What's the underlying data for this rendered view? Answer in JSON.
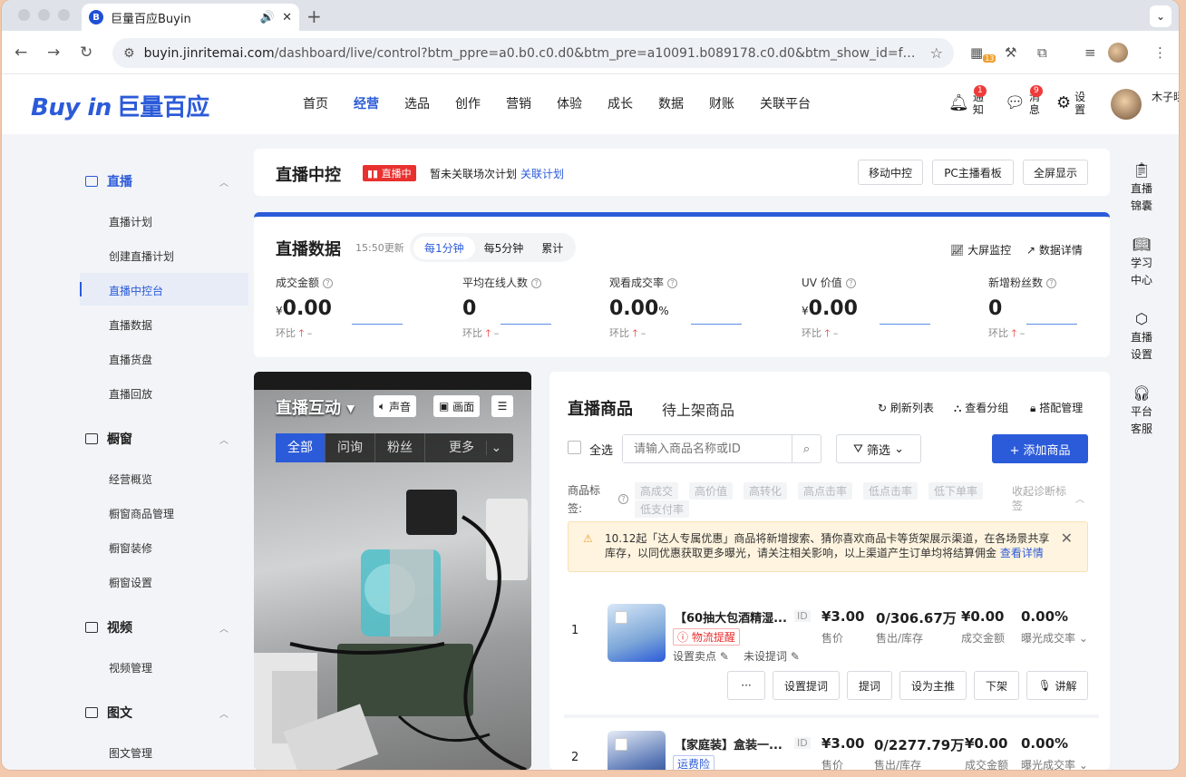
{
  "browser": {
    "tab_title": "巨量百应Buyin",
    "tab_favicon": "B",
    "url_domain": "buyin.jinritemai.com",
    "url_path": "/dashboard/live/control?btm_ppre=a0.b0.c0.d0&btm_pre=a10091.b089178.c0.d0&btm_show_id=fc90986...",
    "ext_badge": "13"
  },
  "header": {
    "logo_en": "Buy in",
    "logo_cn": "巨量百应",
    "nav": [
      "首页",
      "经营",
      "选品",
      "创作",
      "营销",
      "体验",
      "成长",
      "数据",
      "财账",
      "关联平台"
    ],
    "active_nav": "经营",
    "notify_label": "通知",
    "notify_badge": "1",
    "message_label": "消息",
    "message_badge": "9",
    "settings_label": "设置",
    "username": "木子旸"
  },
  "sidebar": {
    "live": "直播",
    "live_items": [
      "直播计划",
      "创建直播计划",
      "直播中控台",
      "直播数据",
      "直播货盘",
      "直播回放"
    ],
    "window": "橱窗",
    "window_items": [
      "经营概览",
      "橱窗商品管理",
      "橱窗装修",
      "橱窗设置"
    ],
    "video": "视频",
    "video_items": [
      "视频管理"
    ],
    "article": "图文",
    "article_items": [
      "图文管理"
    ]
  },
  "rail": [
    "直播锦囊",
    "学习中心",
    "直播设置",
    "平台客服"
  ],
  "control": {
    "title": "直播中控",
    "live_tag": "直播中",
    "plan_text": "暂未关联场次计划",
    "plan_link": "关联计划",
    "buttons": [
      "移动中控",
      "PC主播看板",
      "全屏显示"
    ]
  },
  "stats": {
    "title": "直播数据",
    "updated": "15:50更新",
    "intervals": [
      "每1分钟",
      "每5分钟",
      "累计"
    ],
    "big_screen": "大屏监控",
    "detail": "数据详情",
    "compare": "环比",
    "dash": "–",
    "metrics": [
      {
        "label": "成交金额",
        "prefix": "¥",
        "value": "0.00",
        "suffix": ""
      },
      {
        "label": "平均在线人数",
        "prefix": "",
        "value": "0",
        "suffix": ""
      },
      {
        "label": "观看成交率",
        "prefix": "",
        "value": "0.00",
        "suffix": "%"
      },
      {
        "label": "UV 价值",
        "prefix": "¥",
        "value": "0.00",
        "suffix": ""
      },
      {
        "label": "新增粉丝数",
        "prefix": "",
        "value": "0",
        "suffix": ""
      }
    ]
  },
  "interaction": {
    "title": "直播互动",
    "sound": "声音",
    "picture": "画面",
    "tabs": [
      "全部",
      "问询",
      "粉丝",
      "更多"
    ]
  },
  "goods": {
    "title": "直播商品",
    "pending_tab": "待上架商品",
    "refresh": "刷新列表",
    "groups": "查看分组",
    "bundle": "搭配管理",
    "select_all": "全选",
    "search_placeholder": "请输入商品名称或ID",
    "filter": "筛选",
    "add": "+ 添加商品",
    "tag_label": "商品标签:",
    "tags": [
      "高成交",
      "高价值",
      "高转化",
      "高点击率",
      "低点击率",
      "低下单率",
      "低支付率"
    ],
    "collapse": "收起诊断标签",
    "notice": "10.12起「达人专属优惠」商品将新增搜索、猜你喜欢商品卡等货架展示渠道，在各场景共享库存，以同优惠获取更多曝光，请关注相关影响，以上渠道产生订单均将结算佣金",
    "notice_link": "查看详情",
    "item1": {
      "index": "1",
      "name": "【60抽大包酒精湿...",
      "id": "ID",
      "flag": "物流提醒",
      "sell_point": "设置卖点",
      "prompt": "未设提词",
      "price": "¥3.00",
      "price_label": "售价",
      "sold": "0/306.67万",
      "sold_label": "售出/库存",
      "gmv": "¥0.00",
      "gmv_label": "成交金额",
      "rate": "0.00%",
      "rate_label": "曝光成交率",
      "actions": [
        "···",
        "设置提词",
        "提词",
        "设为主推",
        "下架",
        "讲解"
      ]
    },
    "item2": {
      "index": "2",
      "name": "【家庭装】盒装一...",
      "id": "ID",
      "flag": "运费险",
      "price": "¥3.00",
      "price_label": "售价",
      "sold": "0/2277.79万",
      "sold_label": "售出/库存",
      "gmv": "¥0.00",
      "gmv_label": "成交金额",
      "rate": "0.00%",
      "rate_label": "曝光成交率"
    }
  },
  "colors": {
    "brand": "#2c5bd9",
    "live": "#e8312f",
    "notice_bg": "#fff4df"
  }
}
